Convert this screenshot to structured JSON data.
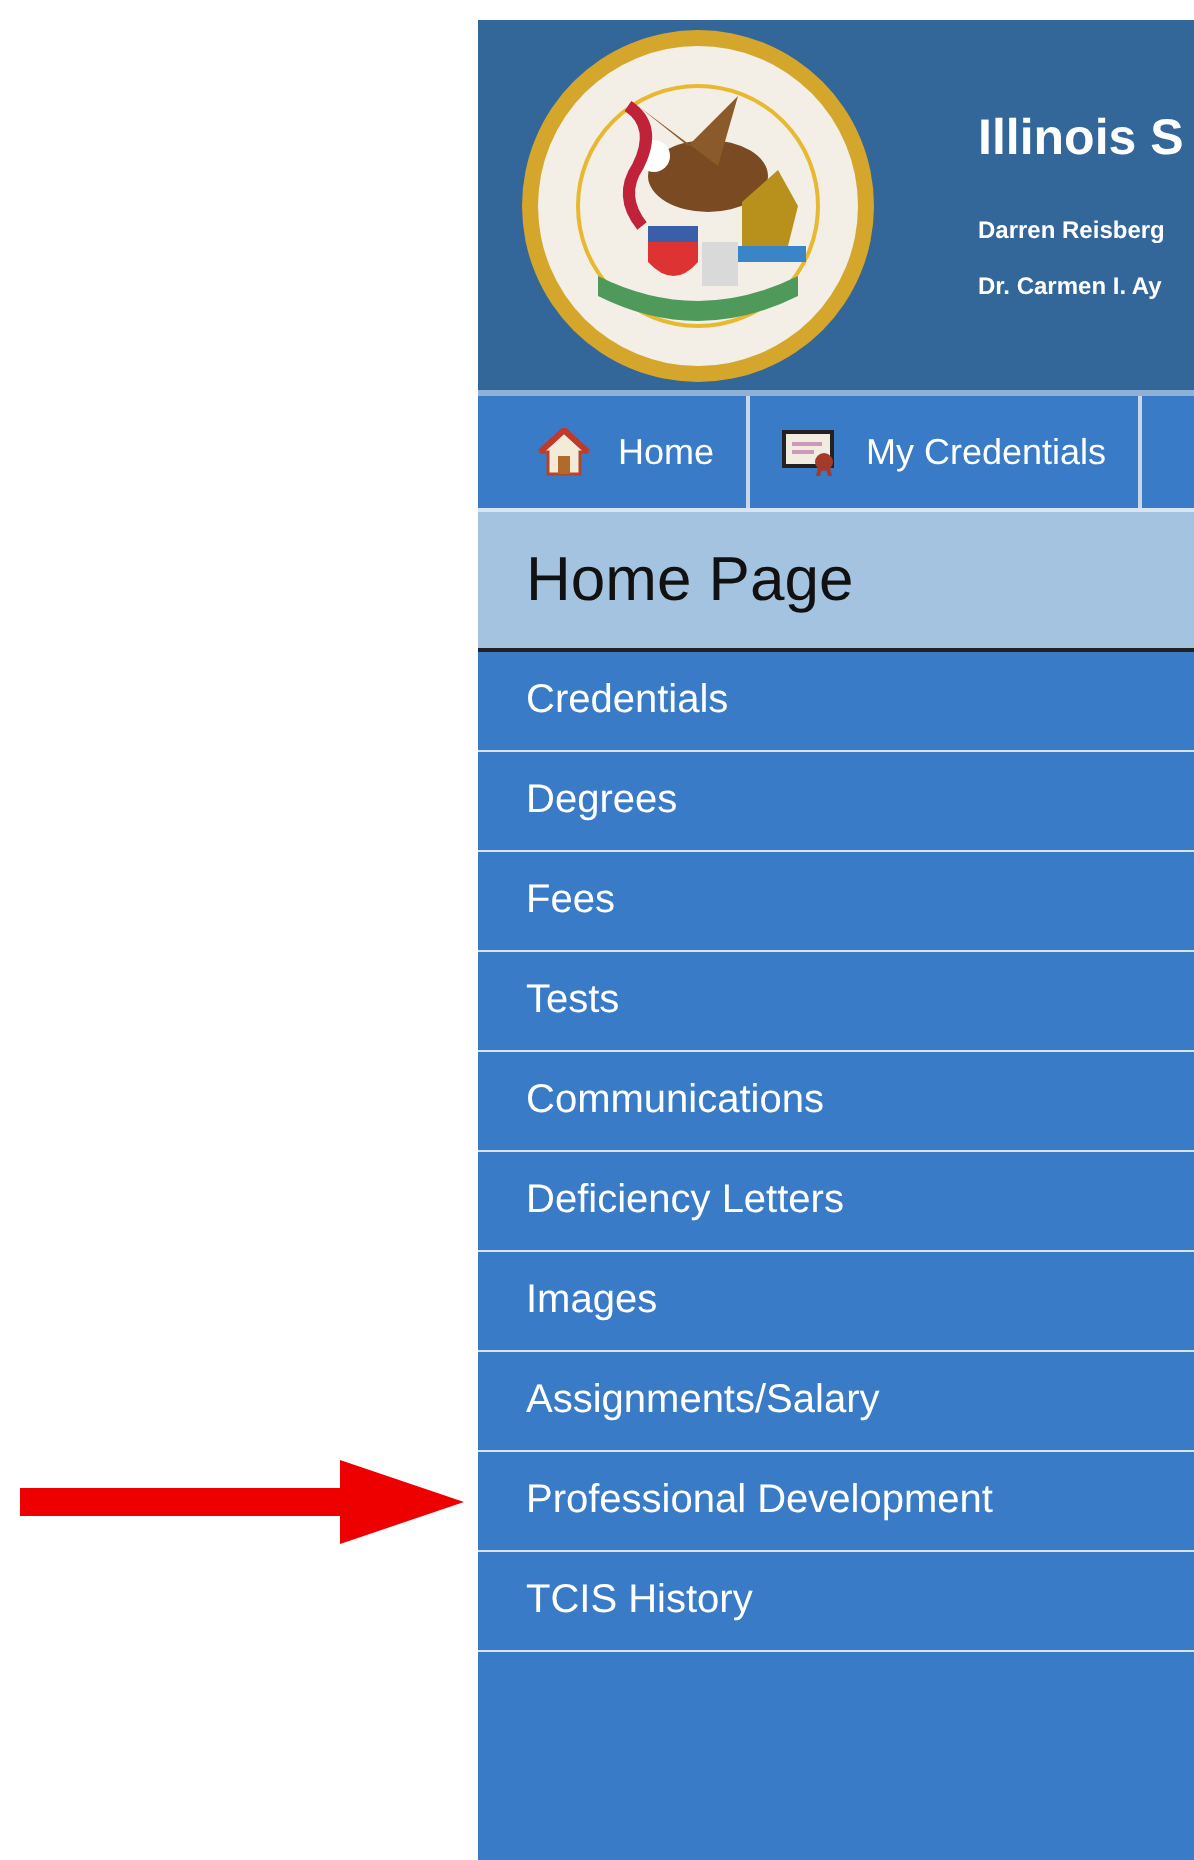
{
  "header": {
    "title": "Illinois S",
    "lines": [
      "Darren Reisberg",
      "Dr. Carmen I. Ay"
    ]
  },
  "nav": [
    {
      "label": "Home",
      "kind": "house"
    },
    {
      "label": "My Credentials",
      "kind": "certificate"
    }
  ],
  "page_title": "Home Page",
  "menu": [
    {
      "label": "Credentials",
      "pointed": false
    },
    {
      "label": "Degrees",
      "pointed": false
    },
    {
      "label": "Fees",
      "pointed": false
    },
    {
      "label": "Tests",
      "pointed": false
    },
    {
      "label": "Communications",
      "pointed": false
    },
    {
      "label": "Deficiency Letters",
      "pointed": false
    },
    {
      "label": "Images",
      "pointed": false
    },
    {
      "label": "Assignments/Salary",
      "pointed": false
    },
    {
      "label": "Professional Development",
      "pointed": true
    },
    {
      "label": "TCIS History",
      "pointed": false
    }
  ]
}
